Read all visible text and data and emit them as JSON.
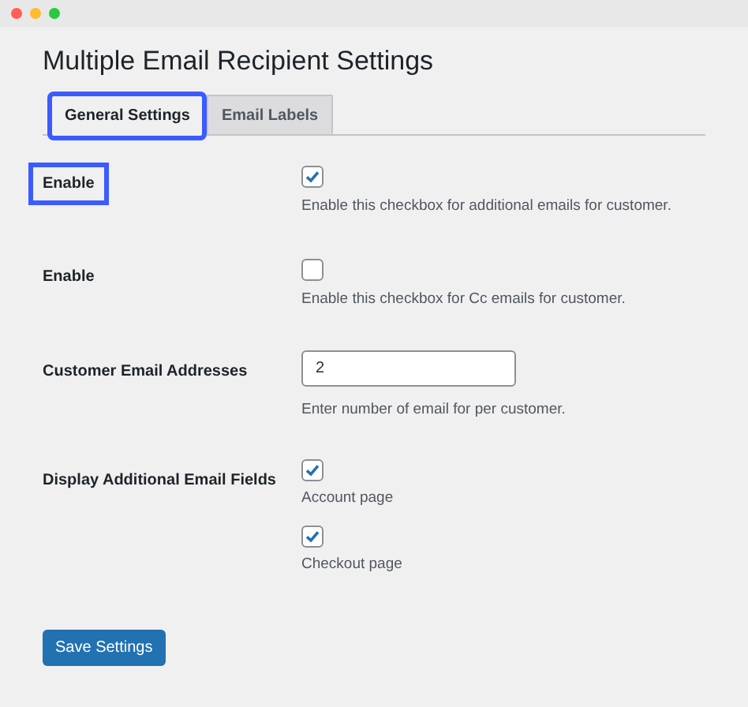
{
  "title": "Multiple Email Recipient Settings",
  "tabs": [
    {
      "label": "General Settings",
      "selected": true,
      "highlighted": true
    },
    {
      "label": "Email Labels",
      "selected": false,
      "highlighted": false
    }
  ],
  "settings": [
    {
      "kind": "checkbox",
      "label": "Enable",
      "highlighted": true,
      "checked": true,
      "description": "Enable this checkbox for additional emails for customer."
    },
    {
      "kind": "checkbox",
      "label": "Enable",
      "highlighted": false,
      "checked": false,
      "description": "Enable this checkbox for Cc emails for customer."
    },
    {
      "kind": "number",
      "label": "Customer Email Addresses",
      "highlighted": false,
      "value": "2",
      "description": "Enter number of email for per customer."
    },
    {
      "kind": "checkbox_group",
      "label": "Display Additional Email Fields",
      "highlighted": false,
      "options": [
        {
          "label": "Account page",
          "checked": true
        },
        {
          "label": "Checkout page",
          "checked": true
        }
      ]
    }
  ],
  "save_button": "Save Settings"
}
